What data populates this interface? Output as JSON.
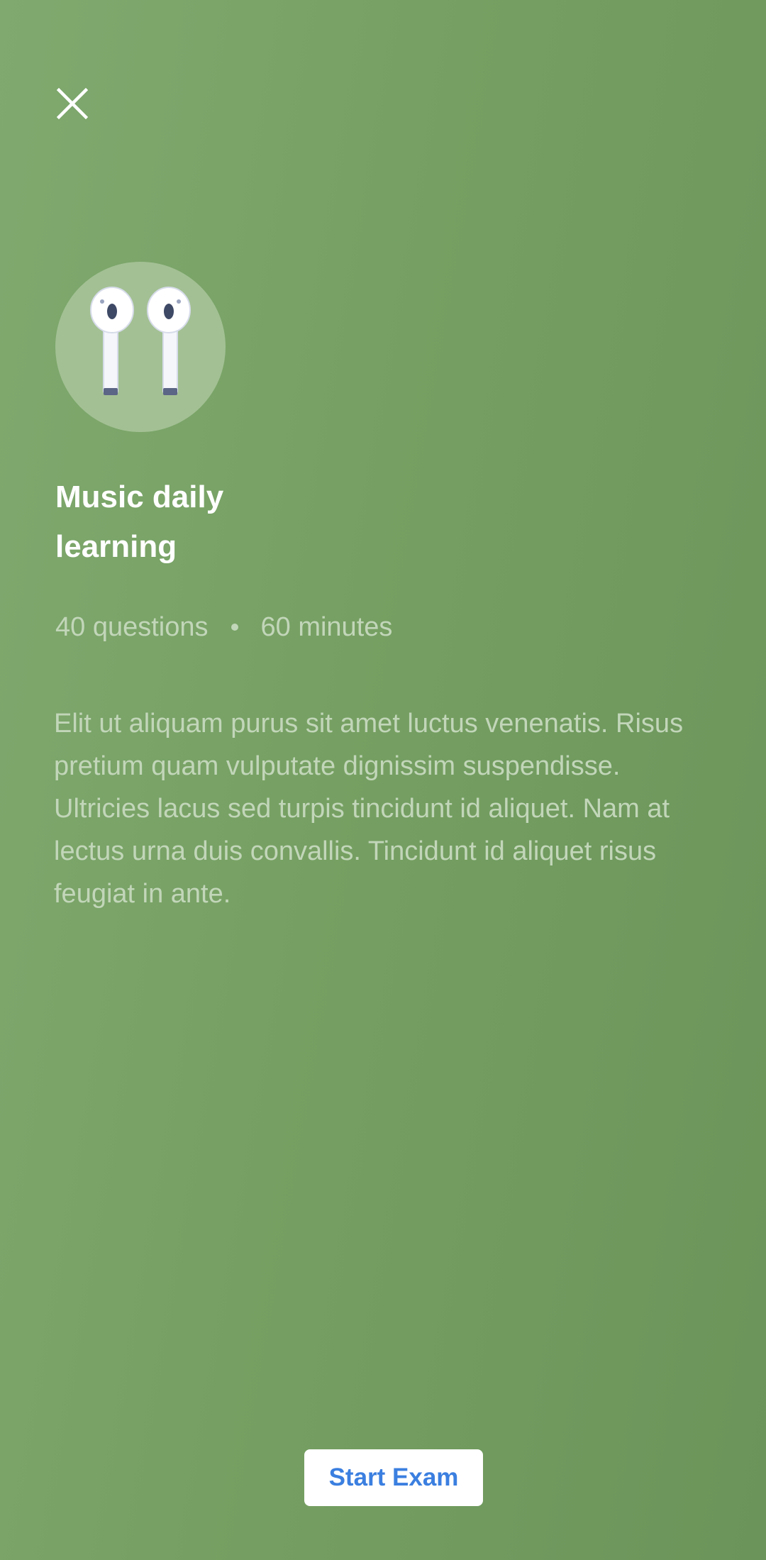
{
  "header": {
    "close_icon": "close-icon"
  },
  "exam": {
    "icon": "earbuds-icon",
    "title": "Music daily learning",
    "questions": "40 questions",
    "duration": "60 minutes",
    "description": "Elit ut aliquam purus sit amet luctus venenatis. Risus pretium quam vulputate dignissim suspendisse. Ultricies lacus sed turpis tincidunt id aliquet. Nam at lectus urna duis convallis. Tincidunt id aliquet risus feugiat in ante."
  },
  "actions": {
    "start_label": "Start Exam"
  },
  "colors": {
    "background_start": "#7fa96e",
    "background_end": "#6a9459",
    "badge": "#a3c094",
    "muted_text": "#c2d6b9",
    "button_text": "#3b7fe0"
  }
}
